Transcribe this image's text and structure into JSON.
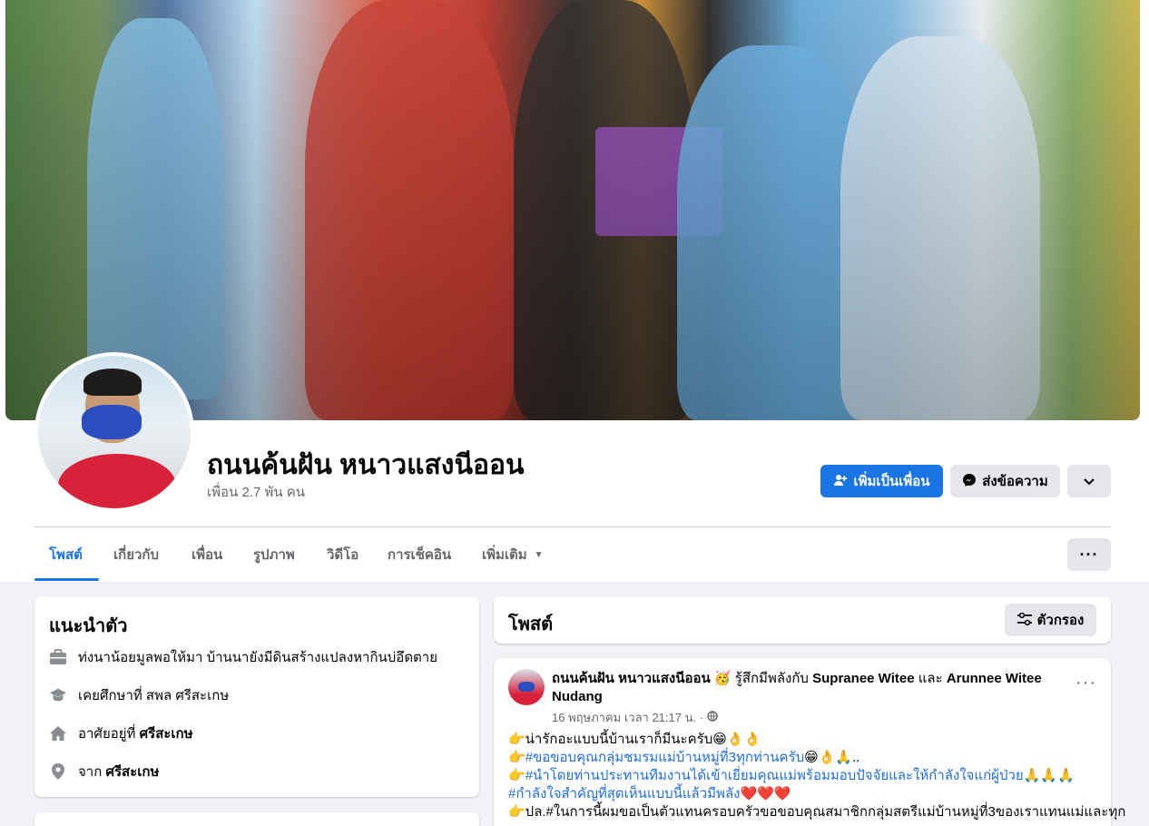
{
  "profile": {
    "name": "ถนนค้นฝัน หนาวแสงนีออน",
    "friends": "เพื่อน 2.7 พัน คน"
  },
  "actions": {
    "add_friend": "เพิ่มเป็นเพื่อน",
    "message": "ส่งข้อความ",
    "more_icon": "chevron-down-icon"
  },
  "tabs": [
    {
      "label": "โพสต์"
    },
    {
      "label": "เกี่ยวกับ"
    },
    {
      "label": "เพื่อน"
    },
    {
      "label": "รูปภาพ"
    },
    {
      "label": "วิดีโอ"
    },
    {
      "label": "การเช็คอิน"
    },
    {
      "label": "เพิ่มเติม"
    }
  ],
  "intro": {
    "title": "แนะนำตัว",
    "items": [
      {
        "icon": "briefcase-icon",
        "text": "ท่งนาน้อยมูลพอให้มา บ้านนายังมีดินสร้างแปลงหากินบ่อึดตาย",
        "bold": ""
      },
      {
        "icon": "graduation-cap-icon",
        "text": "เคยศึกษาที่ สพล ศรีสะเกษ",
        "bold": ""
      },
      {
        "icon": "home-icon",
        "text": "อาศัยอยู่ที่ ",
        "bold": "ศรีสะเกษ"
      },
      {
        "icon": "location-pin-icon",
        "text": "จาก ",
        "bold": "ศรีสะเกษ"
      }
    ]
  },
  "posts_header": {
    "title": "โพสต์",
    "filter": "ตัวกรอง"
  },
  "post": {
    "author": "ถนนค้นฝัน หนาวแสงนีออน",
    "feeling": "🥳 รู้สึกมีพลังกับ",
    "tagged_1": "Supranee Witee",
    "and": "และ",
    "tagged_2": "Arunnee Witee Nudang",
    "time": "16 พฤษภาคม เวลา 21:17 น. ·",
    "lines": [
      {
        "pre": "👉น่ารักอะแบบนี้บ้านเราก็มีนะครับ😁👌👌",
        "tag": "",
        "post": ""
      },
      {
        "pre": "👉",
        "tag": "#ขอขอบคุณกลุ่มชมรมแม่บ้านหมู่ที่3ทุกท่านครับ",
        "post": "😁👌🙏.."
      },
      {
        "pre": "👉",
        "tag": "#นำโดยท่านประทานทีมงานได้เข้าเยี่ยมคุณแม่พร้อมมอบปัจจัยและให้กำลังใจแก่ผู้ป่วย",
        "post": "🙏🙏🙏"
      },
      {
        "pre": "",
        "tag": "#กำลังใจสำคัญที่สุดเห็นแบบนี้แล้วมีพลัง",
        "post": "❤️❤️❤️"
      },
      {
        "pre": "👉ปล.#ในการนี้ผมขอเป็นตัวแทนครอบครัวขอขอบคุณสมาชิกกลุ่มสตรีแม่บ้านหมู่ที่3ของเราแทนแม่และทุก",
        "tag": "",
        "post": ""
      }
    ]
  }
}
